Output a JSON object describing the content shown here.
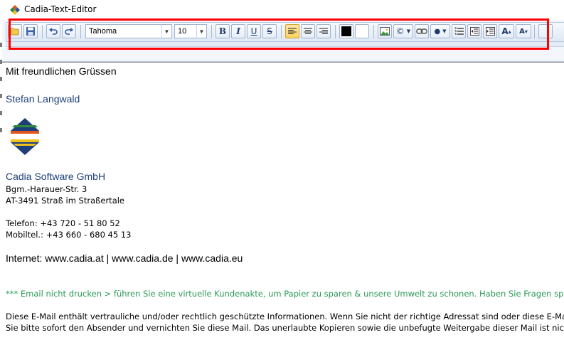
{
  "window": {
    "title": "Cadia-Text-Editor"
  },
  "toolbar": {
    "font_name": "Tahoma",
    "font_size": "10",
    "bold_label": "B",
    "italic_label": "I",
    "underline_label": "U",
    "strike_label": "S",
    "font_grow_label": "A",
    "font_shrink_label": "A",
    "symbol_label": "©",
    "text_color": "#000000",
    "highlight_color": "#ffffff"
  },
  "document": {
    "greeting": "Mit freundlichen Grüssen",
    "name": "Stefan Langwald",
    "company": "Cadia Software GmbH",
    "street": "Bgm.-Harauer-Str. 3",
    "city": "AT-3491 Straß im Straßertale",
    "phone": "Telefon:  +43 720 - 51 80 52",
    "mobile": "Mobiltel.: +43 660 - 680 45 13",
    "internet": "Internet: www.cadia.at | www.cadia.de | www.cadia.eu",
    "eco_note": "*** Email nicht drucken > führen Sie eine virtuelle Kundenakte, um Papier zu sparen & unsere Umwelt zu schonen. Haben Sie Fragen sp",
    "disclaimer_1": "Diese E-Mail enthält vertrauliche und/oder rechtlich geschützte Informationen. Wenn Sie nicht der richtige Adressat sind oder diese E-Mai",
    "disclaimer_2": "Sie bitte sofort den Absender und vernichten Sie diese Mail. Das unerlaubte Kopieren sowie die unbefugte Weitergabe dieser Mail ist nich"
  },
  "colors": {
    "accent_blue": "#1f3f7a",
    "eco_green": "#2a9a56",
    "highlight_red": "#ff0000"
  }
}
